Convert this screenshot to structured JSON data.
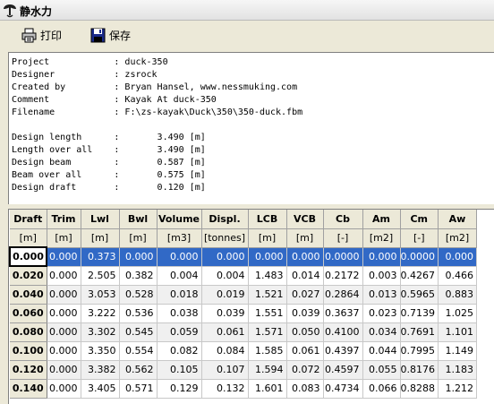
{
  "window": {
    "title": "静水力"
  },
  "toolbar": {
    "print_label": "打印",
    "save_label": "保存"
  },
  "report": {
    "lines": [
      "Project            : duck-350",
      "Designer           : zsrock",
      "Created by         : Bryan Hansel, www.nessmuking.com",
      "Comment            : Kayak At duck-350",
      "Filename           : F:\\zs-kayak\\Duck\\350\\350-duck.fbm",
      "",
      "Design length      :       3.490 [m]",
      "Length over all    :       3.490 [m]",
      "Design beam        :       0.587 [m]",
      "Beam over all      :       0.575 [m]",
      "Design draft       :       0.120 [m]"
    ]
  },
  "table": {
    "columns": [
      {
        "name": "Draft",
        "unit": "[m]"
      },
      {
        "name": "Trim",
        "unit": "[m]"
      },
      {
        "name": "Lwl",
        "unit": "[m]"
      },
      {
        "name": "Bwl",
        "unit": "[m]"
      },
      {
        "name": "Volume",
        "unit": "[m3]"
      },
      {
        "name": "Displ.",
        "unit": "[tonnes]"
      },
      {
        "name": "LCB",
        "unit": "[m]"
      },
      {
        "name": "VCB",
        "unit": "[m]"
      },
      {
        "name": "Cb",
        "unit": "[-]"
      },
      {
        "name": "Am",
        "unit": "[m2]"
      },
      {
        "name": "Cm",
        "unit": "[-]"
      },
      {
        "name": "Aw",
        "unit": "[m2]"
      }
    ],
    "selected_row": 0,
    "rows": [
      [
        "0.000",
        "0.000",
        "0.373",
        "0.000",
        "0.000",
        "0.000",
        "0.000",
        "0.000",
        "0.0000",
        "0.000",
        "0.0000",
        "0.000"
      ],
      [
        "0.020",
        "0.000",
        "2.505",
        "0.382",
        "0.004",
        "0.004",
        "1.483",
        "0.014",
        "0.2172",
        "0.003",
        "0.4267",
        "0.466"
      ],
      [
        "0.040",
        "0.000",
        "3.053",
        "0.528",
        "0.018",
        "0.019",
        "1.521",
        "0.027",
        "0.2864",
        "0.013",
        "0.5965",
        "0.883"
      ],
      [
        "0.060",
        "0.000",
        "3.222",
        "0.536",
        "0.038",
        "0.039",
        "1.551",
        "0.039",
        "0.3637",
        "0.023",
        "0.7139",
        "1.025"
      ],
      [
        "0.080",
        "0.000",
        "3.302",
        "0.545",
        "0.059",
        "0.061",
        "1.571",
        "0.050",
        "0.4100",
        "0.034",
        "0.7691",
        "1.101"
      ],
      [
        "0.100",
        "0.000",
        "3.350",
        "0.554",
        "0.082",
        "0.084",
        "1.585",
        "0.061",
        "0.4397",
        "0.044",
        "0.7995",
        "1.149"
      ],
      [
        "0.120",
        "0.000",
        "3.382",
        "0.562",
        "0.105",
        "0.107",
        "1.594",
        "0.072",
        "0.4597",
        "0.055",
        "0.8176",
        "1.183"
      ],
      [
        "0.140",
        "0.000",
        "3.405",
        "0.571",
        "0.129",
        "0.132",
        "1.601",
        "0.083",
        "0.4734",
        "0.066",
        "0.8288",
        "1.212"
      ]
    ]
  }
}
